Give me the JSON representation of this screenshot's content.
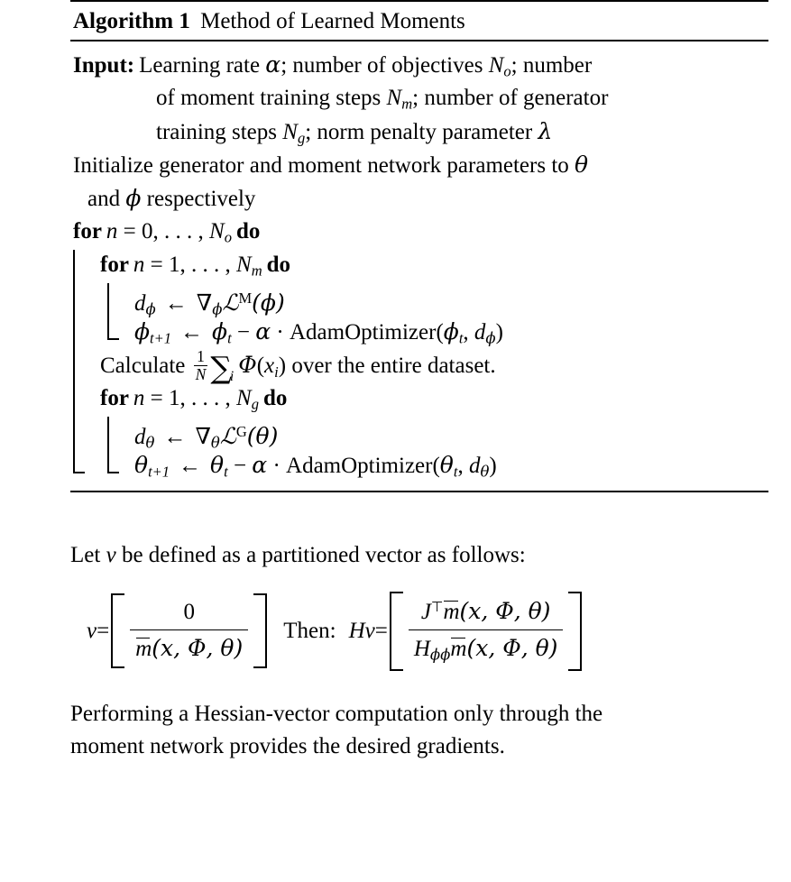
{
  "algorithm": {
    "label": "Algorithm 1",
    "title": "Method of Learned Moments",
    "input_label": "Input:",
    "input_line1_a": "Learning rate ",
    "input_alpha": "α",
    "input_line1_b": "; number of objectives ",
    "input_No": "N",
    "input_No_sub": "o",
    "input_line1_c": "; number",
    "input_line2_a": "of moment training steps ",
    "input_Nm": "N",
    "input_Nm_sub": "m",
    "input_line2_b": "; number of generator",
    "input_line3_a": "training steps ",
    "input_Ng": "N",
    "input_Ng_sub": "g",
    "input_line3_b": "; norm penalty parameter ",
    "input_lambda": "λ",
    "init_line1": "Initialize generator and moment network parameters to ",
    "init_theta": "θ",
    "init_line2_a": "and ",
    "init_phi": "ϕ",
    "init_line2_b": " respectively",
    "for_kw": "for",
    "do_kw": "do",
    "outer_loop": {
      "var": "n",
      "eq": " = 0, . . . , ",
      "bound": "N",
      "bound_sub": "o"
    },
    "moment_loop": {
      "var": "n",
      "eq": " = 1, . . . , ",
      "bound": "N",
      "bound_sub": "m"
    },
    "moment_grad": {
      "d": "d",
      "d_sub": "ϕ",
      "arrow": "←",
      "nabla": "∇",
      "nabla_sub": "ϕ",
      "loss": "ℒ",
      "loss_sup": "M",
      "arg": "(ϕ)"
    },
    "moment_update": {
      "var": "ϕ",
      "var_sub": "t+1",
      "arrow": "←",
      "cur": "ϕ",
      "cur_sub": "t",
      "minus": " − ",
      "alpha": "α",
      "dot": " · ",
      "optimizer": "AdamOptimizer",
      "args_open": "(",
      "a1": "ϕ",
      "a1_sub": "t",
      "comma": ", ",
      "a2": "d",
      "a2_sub": "ϕ",
      "args_close": ")"
    },
    "calculate": {
      "prefix": "Calculate ",
      "frac_num": "1",
      "frac_den": "N",
      "sum": "∑",
      "sum_sub": "i",
      "phi_cap": "Φ",
      "arg_open": "(",
      "arg_var": "x",
      "arg_sub": "i",
      "arg_close": ")",
      "suffix": " over the entire dataset."
    },
    "gen_loop": {
      "var": "n",
      "eq": " = 1, . . . , ",
      "bound": "N",
      "bound_sub": "g"
    },
    "gen_grad": {
      "d": "d",
      "d_sub": "θ",
      "arrow": "←",
      "nabla": "∇",
      "nabla_sub": "θ",
      "loss": "ℒ",
      "loss_sup": "G",
      "arg": "(θ)"
    },
    "gen_update": {
      "var": "θ",
      "var_sub": "t+1",
      "arrow": "←",
      "cur": "θ",
      "cur_sub": "t",
      "minus": " − ",
      "alpha": "α",
      "dot": " · ",
      "optimizer": "AdamOptimizer",
      "args_open": "(",
      "a1": "θ",
      "a1_sub": "t",
      "comma": ", ",
      "a2": "d",
      "a2_sub": "θ",
      "args_close": ")"
    }
  },
  "prose": {
    "intro_a": "Let ",
    "intro_v": "v",
    "intro_b": " be defined as a partitioned vector as follows:",
    "closing_line1": "Performing a Hessian-vector computation only through the",
    "closing_line2": "moment network provides the desired gradients."
  },
  "equation": {
    "lhs_var": "v",
    "lhs_eq": " = ",
    "lhs_row1": "0",
    "lhs_row2_m": "m",
    "lhs_row2_args": "(x, Φ, θ)",
    "then_label": "Then:",
    "rhs_H": "H",
    "rhs_v": "v",
    "rhs_eq": " = ",
    "rhs_row1_J": "J",
    "rhs_row1_T": "⊤",
    "rhs_row1_m": "m",
    "rhs_row1_args": "(x, Φ, θ)",
    "rhs_row2_H": "H",
    "rhs_row2_sub": "ϕϕ",
    "rhs_row2_m": "m",
    "rhs_row2_args": "(x, Φ, θ)"
  }
}
